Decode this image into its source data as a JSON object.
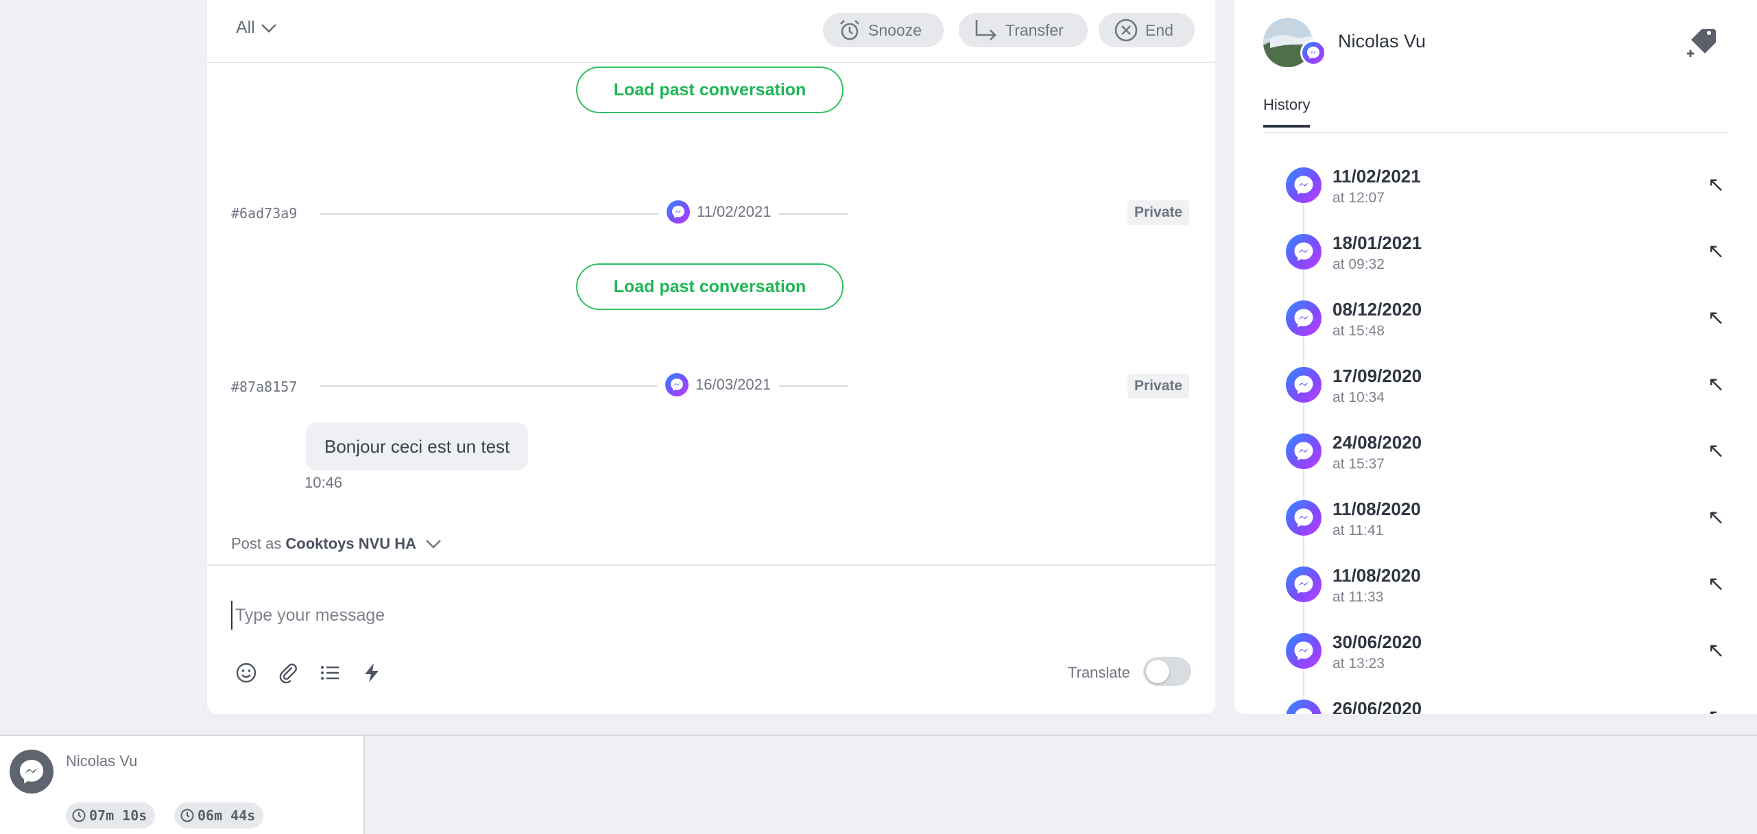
{
  "chat": {
    "filter_label": "All",
    "actions": {
      "snooze": "Snooze",
      "transfer": "Transfer",
      "end": "End"
    },
    "load_past_label": "Load past conversation",
    "separators": [
      {
        "id": "#6ad73a9",
        "date": "11/02/2021",
        "visibility": "Private"
      },
      {
        "id": "#87a8157",
        "date": "16/03/2021",
        "visibility": "Private"
      }
    ],
    "message": {
      "text": "Bonjour ceci est un test",
      "time": "10:46"
    },
    "post_as": {
      "prefix": "Post as",
      "account": "Cooktoys NVU HA"
    },
    "composer": {
      "placeholder": "Type your message",
      "translate_label": "Translate",
      "translate_enabled": false
    }
  },
  "contact": {
    "name": "Nicolas Vu",
    "tabs": {
      "history": "History"
    },
    "history": [
      {
        "date": "11/02/2021",
        "time": "at 12:07"
      },
      {
        "date": "18/01/2021",
        "time": "at 09:32"
      },
      {
        "date": "08/12/2020",
        "time": "at 15:48"
      },
      {
        "date": "17/09/2020",
        "time": "at 10:34"
      },
      {
        "date": "24/08/2020",
        "time": "at 15:37"
      },
      {
        "date": "11/08/2020",
        "time": "at 11:41"
      },
      {
        "date": "11/08/2020",
        "time": "at 11:33"
      },
      {
        "date": "30/06/2020",
        "time": "at 13:23"
      },
      {
        "date": "26/06/2020",
        "time": ""
      }
    ]
  },
  "queue": {
    "name": "Nicolas Vu",
    "timers": [
      "07m 10s",
      "06m 44s"
    ]
  },
  "icons": {
    "channel": "messenger-icon",
    "open_history": "arrow-up-left-icon",
    "add_tag": "tag-plus-icon"
  },
  "colors": {
    "accent_green": "#1fb654",
    "messenger_gradient": [
      "#2d8cff",
      "#7b4dff",
      "#c23cff"
    ],
    "background": "#eef0f5"
  }
}
